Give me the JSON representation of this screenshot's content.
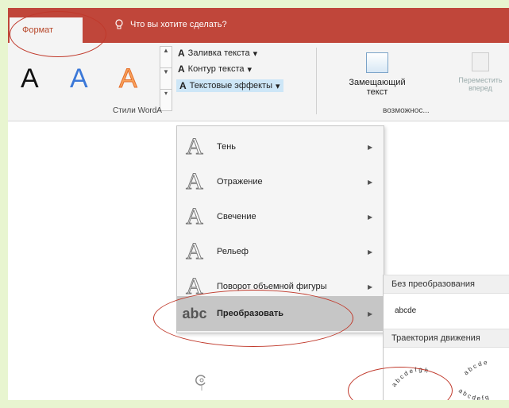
{
  "ribbon": {
    "active_tab": "Формат",
    "tell_me": "Что вы хотите сделать?",
    "text_fill": "Заливка текста",
    "text_outline": "Контур текста",
    "text_effects": "Текстовые эффекты",
    "wordart_letter": "A",
    "group_styles": "Стили WordA",
    "group_access": "возможнос...",
    "placeholder_label1": "Замещающий",
    "placeholder_label2": "текст",
    "move_label1": "Переместить",
    "move_label2": "вперед"
  },
  "menu": {
    "items": [
      {
        "label": "Тень",
        "icon": "A"
      },
      {
        "label": "Отражение",
        "icon": "A"
      },
      {
        "label": "Свечение",
        "icon": "A"
      },
      {
        "label": "Рельеф",
        "icon": "A"
      },
      {
        "label": "Поворот объемной фигуры",
        "icon": "A"
      },
      {
        "label": "Преобразовать",
        "icon": "abc"
      }
    ]
  },
  "submenu": {
    "no_transform": "Без преобразования",
    "abcde": "abcde",
    "path": "Траектория движения"
  },
  "colors": {
    "accent": "#c0463a",
    "annotation": "#c0392b",
    "background": "#e8f5d0"
  }
}
